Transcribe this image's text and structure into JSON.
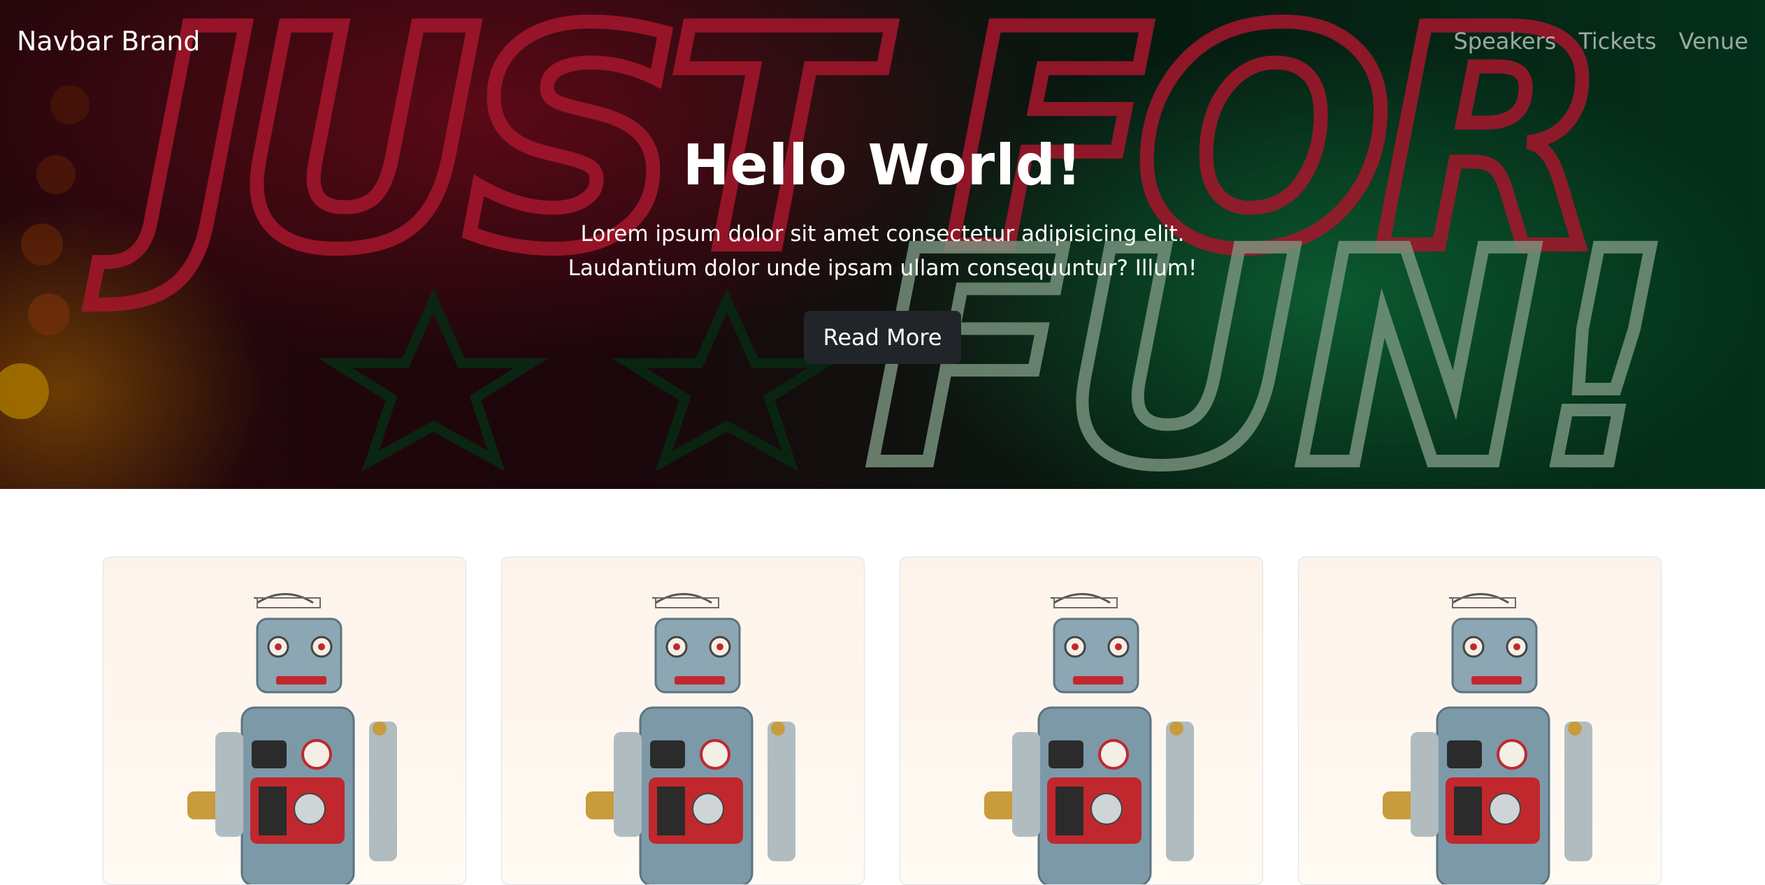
{
  "navbar": {
    "brand": "Navbar Brand",
    "links": [
      "Speakers",
      "Tickets",
      "Venue"
    ]
  },
  "hero": {
    "title": "Hello World!",
    "text_line1": "Lorem ipsum dolor sit amet consectetur adipisicing elit.",
    "text_line2": "Laudantium dolor unde ipsam ullam consequuntur? Illum!",
    "button": "Read More",
    "sign_top": "JUST FOR",
    "sign_bottom": "FUN!"
  },
  "cards": [
    {
      "image": "robot-toy-image"
    },
    {
      "image": "robot-toy-image"
    },
    {
      "image": "robot-toy-image"
    },
    {
      "image": "robot-toy-image"
    }
  ],
  "colors": {
    "button_bg": "#212529",
    "neon_red": "#ff2244",
    "neon_green": "#38e07a"
  }
}
